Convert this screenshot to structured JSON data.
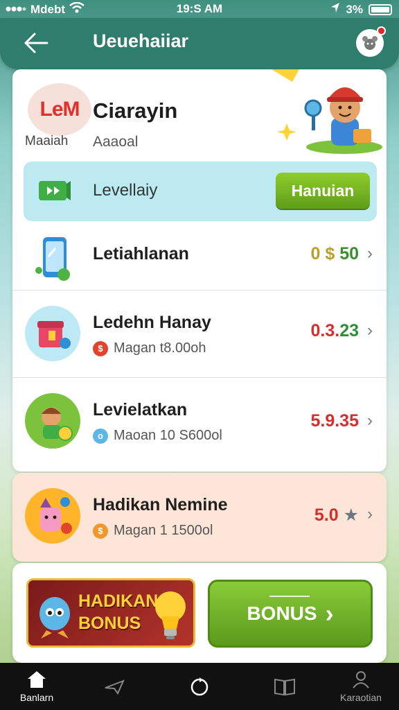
{
  "status_bar": {
    "carrier": "Mdebt",
    "time": "19:S AM",
    "battery": "3%"
  },
  "app_bar": {
    "title": "Ueuehaiiar"
  },
  "profile": {
    "logo_text": "LeM",
    "logo_caption": "Maaiah",
    "name": "Ciarayin",
    "subtitle": "Aaaoal"
  },
  "level_banner": {
    "label": "Levellaiy",
    "button_label": "Hanuian"
  },
  "list_items": [
    {
      "title": "Letiahlanan",
      "subtitle": "",
      "value_left": "0 $",
      "value_right": "50",
      "value_left_color": "#b8a12a",
      "value_right_color": "#3b8f2a"
    },
    {
      "title": "Ledehn Hanay",
      "subtitle": "Magan t8.00oh",
      "value_left": "0.3.",
      "value_right": "23",
      "value_left_color": "#d62d2d",
      "value_right_color": "#2d8f3a"
    },
    {
      "title": "Levielatkan",
      "subtitle": "Maoan 10 S600ol",
      "value_left": "5.9.35",
      "value_right": "",
      "value_left_color": "#d62d2d",
      "value_right_color": "#d62d2d"
    }
  ],
  "hadikan": {
    "title": "Hadikan Nemine",
    "subtitle": "Magan  1 1500ol",
    "value": "5.0",
    "value_color": "#d62d2d"
  },
  "bonus": {
    "banner_line1": "HADIKAN",
    "banner_line2": "BONUS",
    "button_label": "BONUS"
  },
  "bottom_nav": {
    "items": [
      {
        "label": "Banlarn",
        "icon": "home-icon"
      },
      {
        "label": "",
        "icon": "plane-icon"
      },
      {
        "label": "",
        "icon": "refresh-icon"
      },
      {
        "label": "",
        "icon": "book-icon"
      },
      {
        "label": "Karaotian",
        "icon": "profile-icon"
      }
    ]
  },
  "colors": {
    "app_bar": "#2f7d6d",
    "accent_green": "#6aae1f",
    "level_banner": "#bde9f0",
    "hadikan_bg": "#fde6d7"
  }
}
